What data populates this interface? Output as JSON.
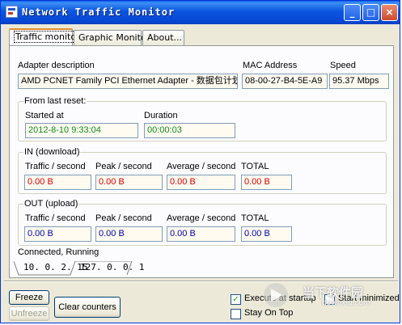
{
  "window": {
    "title": "Network Traffic Monitor",
    "minimize": "_",
    "maximize": "□",
    "close": "×"
  },
  "tabs": [
    "Traffic monitor",
    "Graphic Monitor",
    "About..."
  ],
  "adapter": {
    "description_label": "Adapter description",
    "description": "AMD PCNET Family PCI Ethernet Adapter - 数据包计划",
    "mac_label": "MAC Address",
    "mac": "08-00-27-B4-5E-A9",
    "speed_label": "Speed",
    "speed": "95.37 Mbps"
  },
  "reset": {
    "group_title": "From last reset:",
    "started_label": "Started at",
    "started": "2012-8-10 9:33:04",
    "duration_label": "Duration",
    "duration": "00:00:03"
  },
  "in": {
    "group_title": "IN (download)",
    "labels": [
      "Traffic / second",
      "Peak / second",
      "Average / second",
      "TOTAL"
    ],
    "values": [
      "0.00 B",
      "0.00 B",
      "0.00 B",
      "0.00 B"
    ]
  },
  "out": {
    "group_title": "OUT (upload)",
    "labels": [
      "Traffic / second",
      "Peak / second",
      "Average / second",
      "TOTAL"
    ],
    "values": [
      "0.00 B",
      "0.00 B",
      "0.00 B",
      "0.00 B"
    ]
  },
  "status": "Connected, Running",
  "ip_tabs": [
    "10. 0. 2. 15",
    "127. 0. 0. 1"
  ],
  "buttons": {
    "freeze": "Freeze",
    "unfreeze": "Unfreeze",
    "clear": "Clear counters"
  },
  "options": {
    "execute_startup": "Execute at startup",
    "execute_startup_checked": true,
    "start_minimized": "Start minimized",
    "start_minimized_checked": false,
    "stay_on_top": "Stay On Top",
    "stay_on_top_checked": false
  },
  "watermark": {
    "text": "当下软件园",
    "sub": "downxia.com"
  }
}
